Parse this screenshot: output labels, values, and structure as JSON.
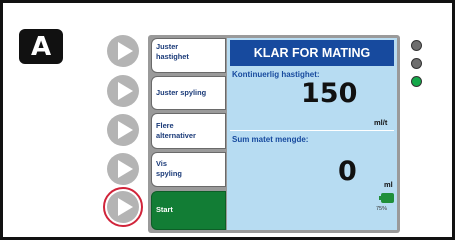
{
  "panel": {
    "label": "A"
  },
  "leds": [
    {
      "state": "off",
      "color": "#6e6e6e"
    },
    {
      "state": "off",
      "color": "#6e6e6e"
    },
    {
      "state": "on",
      "color": "#15a84a"
    }
  ],
  "softkeys": [
    {
      "line1": "Juster",
      "line2": "hastighet"
    },
    {
      "line1": "Juster spyling",
      "line2": ""
    },
    {
      "line1": "Flere",
      "line2": "alternativer"
    },
    {
      "line1": "Vis",
      "line2": "spyling"
    },
    {
      "line1": "Start",
      "line2": ""
    }
  ],
  "display": {
    "status_title": "KLAR FOR MATING",
    "rate_label": "Kontinuerlig hastighet:",
    "rate_value": "150",
    "rate_unit": "ml/t",
    "volume_label": "Sum matet mengde:",
    "volume_value": "0",
    "volume_unit": "ml",
    "battery_text": "75%"
  },
  "colors": {
    "title_bar": "#174a9e",
    "display_bg": "#b7dcf2",
    "start_button": "#127d35",
    "highlight_ring": "#d0243a",
    "hard_button": "#b4b4b4"
  }
}
